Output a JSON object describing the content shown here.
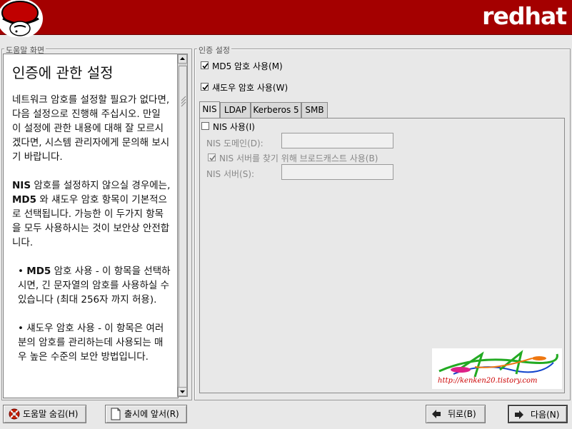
{
  "header": {
    "brand": "redhat"
  },
  "help": {
    "frame_title": "도움말 화면",
    "title": "인증에 관한 설정",
    "para1": "네트워크 암호를 설정할 필요가 없다면, 다음 설정으로 진행해 주십시오. 만일 이 설정에 관한 내용에 대해 잘 모르시겠다면, 시스템 관리자에게 문의해 보시기 바랍니다.",
    "para2_bold1": "NIS",
    "para2_a": " 암호를 설정하지 않으실 경우에는, ",
    "para2_bold2": "MD5",
    "para2_b": " 와 섀도우 암호 항목이 기본적으로 선택됩니다. 가능한 이 두가지 항목을 모두 사용하시는 것이 보안상 안전합니다.",
    "bullet1_bold": "MD5",
    "bullet1_text": " 암호 사용 - 이 항목을 선택하시면, 긴 문자열의 암호를 사용하실 수 있습니다 (최대 256자 까지 허용).",
    "bullet2_text": "섀도우 암호 사용 - 이 항목은 여러분의 암호를 관리하는데 사용되는 매우 높은 수준의 보안 방법입니다."
  },
  "auth": {
    "frame_title": "인증 설정",
    "md5_label": "MD5 암호 사용(M)",
    "md5_checked": true,
    "shadow_label": "섀도우 암호 사용(W)",
    "shadow_checked": true,
    "tabs": [
      "NIS",
      "LDAP",
      "Kerberos 5",
      "SMB"
    ],
    "active_tab": "NIS",
    "nis": {
      "enable_label": "NIS 사용(I)",
      "enable_checked": false,
      "domain_label": "NIS 도메인(D):",
      "domain_value": "",
      "broadcast_label": "NIS 서버를 찾기 위해 브로드캐스트 사용(B)",
      "broadcast_checked": true,
      "server_label": "NIS 서버(S):",
      "server_value": ""
    }
  },
  "watermark": {
    "url": "http://kenken20.tistory.com"
  },
  "buttons": {
    "hide_help": "도움말 숨김(H)",
    "release_notes": "출시에 앞서(R)",
    "back": "뒤로(B)",
    "next": "다음(N)"
  }
}
